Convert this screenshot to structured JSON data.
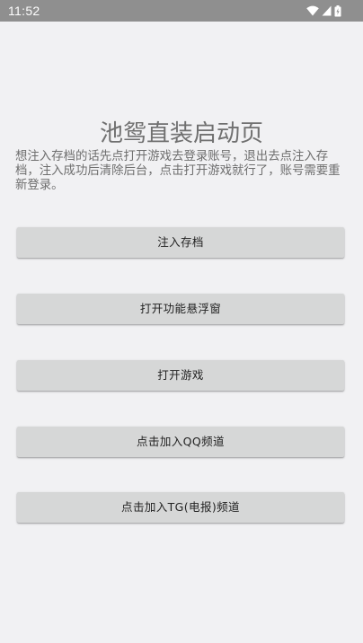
{
  "status_bar": {
    "time": "11:52",
    "icons": [
      "wifi-icon",
      "signal-icon",
      "battery-icon"
    ],
    "background": "#8f8f8f"
  },
  "main": {
    "title": "池鸳直装启动页",
    "description": "想注入存档的话先点打开游戏去登录账号，退出去点注入存档，注入成功后清除后台，点击打开游戏就行了，账号需要重新登录。",
    "buttons": [
      {
        "label": "注入存档"
      },
      {
        "label": "打开功能悬浮窗"
      },
      {
        "label": "打开游戏"
      },
      {
        "label": "点击加入QQ频道"
      },
      {
        "label": "点击加入TG(电报)频道"
      }
    ]
  },
  "colors": {
    "page_background": "#f1f1f3",
    "button_background": "#d6d7d7",
    "title_text": "#707070"
  }
}
